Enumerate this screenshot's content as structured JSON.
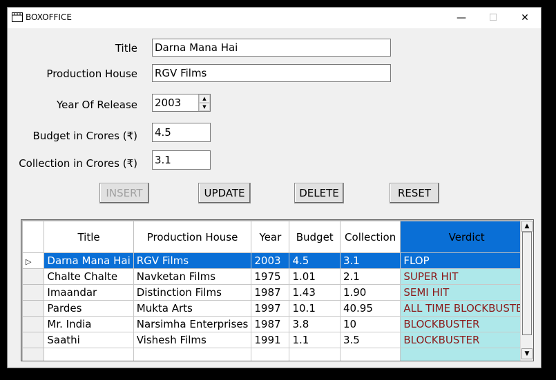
{
  "window": {
    "title": "BOXOFFICE",
    "min_glyph": "—",
    "max_glyph": "☐",
    "close_glyph": "✕"
  },
  "form": {
    "title_label": "Title",
    "title_value": "Darna Mana Hai",
    "production_label": "Production House",
    "production_value": "RGV Films",
    "year_label": "Year Of Release",
    "year_value": "2003",
    "budget_label": "Budget in Crores (₹)",
    "budget_value": "4.5",
    "collection_label": "Collection in Crores (₹)",
    "collection_value": "3.1"
  },
  "buttons": {
    "insert": "INSERT",
    "update": "UPDATE",
    "delete": "DELETE",
    "reset": "RESET",
    "insert_enabled": false
  },
  "grid": {
    "columns": [
      "Title",
      "Production House",
      "Year",
      "Budget",
      "Collection",
      "Verdict"
    ],
    "rows": [
      [
        "Darna Mana Hai",
        "RGV Films",
        "2003",
        "4.5",
        "3.1",
        "FLOP"
      ],
      [
        "Chalte Chalte",
        "Navketan Films",
        "1975",
        "1.01",
        "2.1",
        "SUPER HIT"
      ],
      [
        "Imaandar",
        "Distinction Films",
        "1987",
        "1.43",
        "1.90",
        "SEMI HIT"
      ],
      [
        "Pardes",
        "Mukta Arts",
        "1997",
        "10.1",
        "40.95",
        "ALL TIME BLOCKBUSTER"
      ],
      [
        "Mr. India",
        "Narsimha Enterprises",
        "1987",
        "3.8",
        "10",
        "BLOCKBUSTER"
      ],
      [
        "Saathi",
        "Vishesh Films",
        "1991",
        "1.1",
        "3.5",
        "BLOCKBUSTER"
      ]
    ],
    "selected_row": 0,
    "current_row_marker": "▷"
  },
  "colors": {
    "selection": "#0a6fd6",
    "verdict_bg": "#aee8ea",
    "verdict_text": "#8b1a1a"
  }
}
